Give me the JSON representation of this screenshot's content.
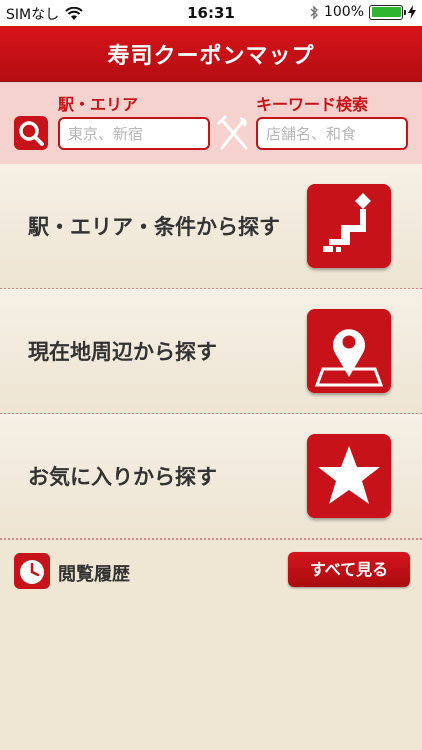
{
  "status_bar": {
    "carrier": "SIMなし",
    "time": "16:31",
    "battery_percent": "100%",
    "battery_level": 1.0
  },
  "nav": {
    "title": "寿司クーポンマップ"
  },
  "search": {
    "area_label": "駅・エリア",
    "area_placeholder": "東京、新宿",
    "keyword_label": "キーワード検索",
    "keyword_placeholder": "店舗名、和食"
  },
  "menu": [
    {
      "label": "駅・エリア・条件から探す",
      "icon": "japan-map-icon"
    },
    {
      "label": "現在地周辺から探す",
      "icon": "location-pin-icon"
    },
    {
      "label": "お気に入りから探す",
      "icon": "star-icon"
    }
  ],
  "history": {
    "label": "閲覧履歴",
    "see_all_label": "すべて見る",
    "icon": "clock-icon"
  },
  "colors": {
    "brand_red": "#c8121a",
    "search_bg": "#f5d2cd",
    "page_bg": "#efe6d4"
  }
}
